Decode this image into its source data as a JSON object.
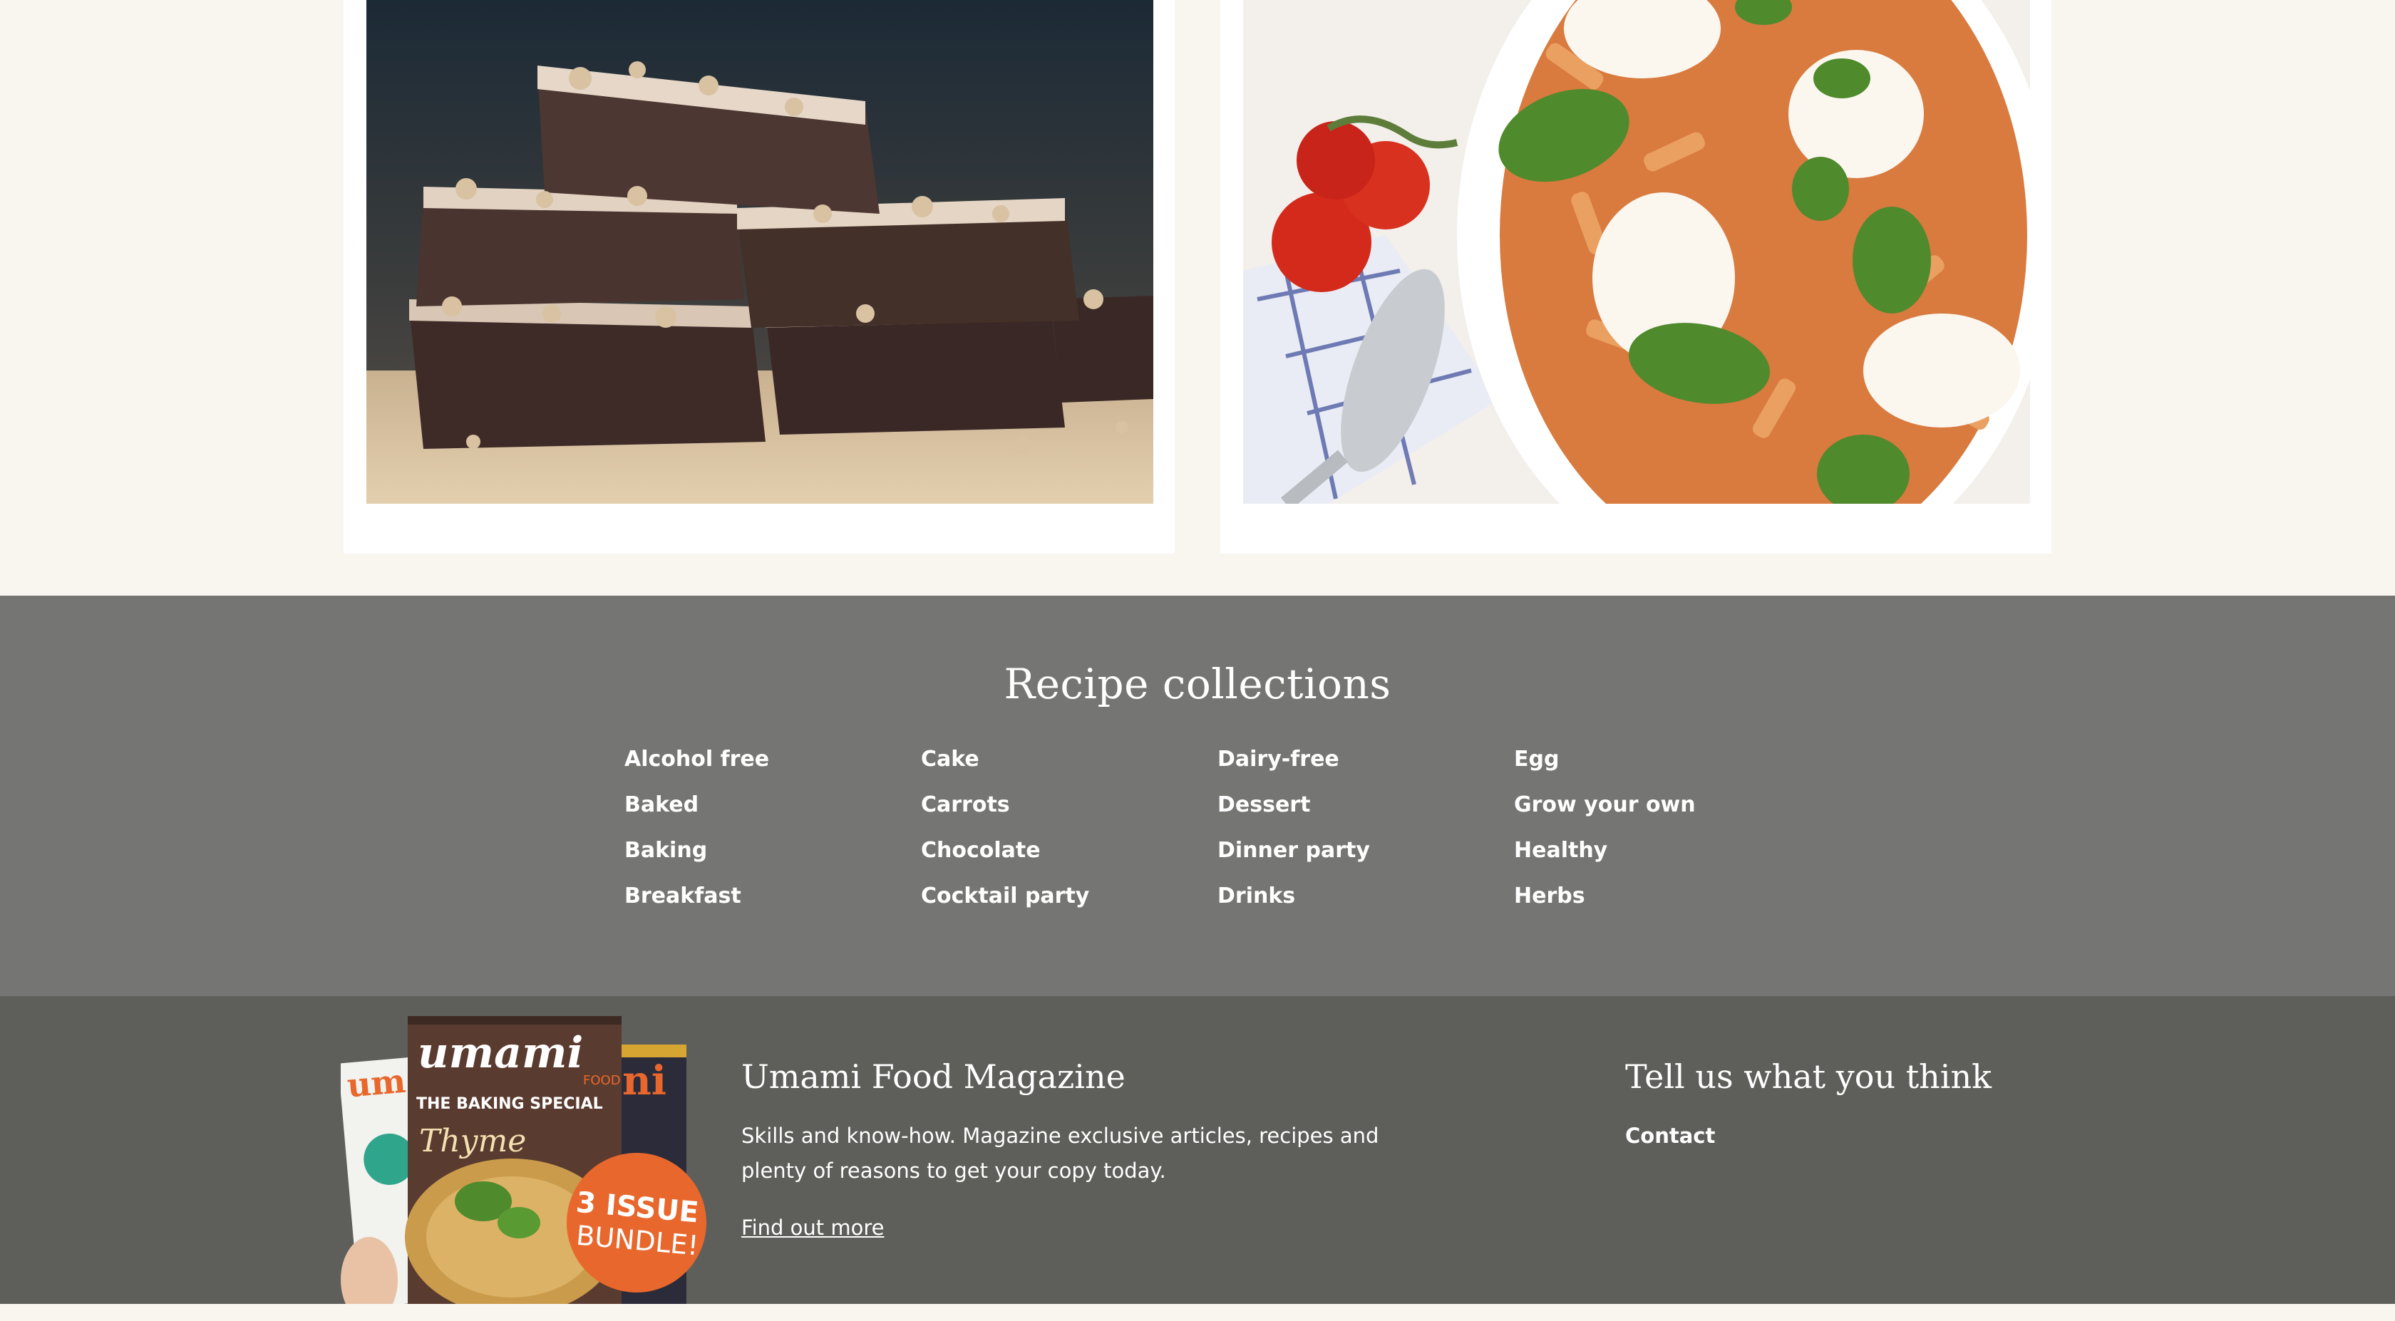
{
  "cards": [
    {
      "image": "chocolate-walnut-brownies-photo"
    },
    {
      "image": "baked-pasta-mozzarella-basil-photo"
    }
  ],
  "collections": {
    "title": "Recipe collections",
    "columns": [
      [
        "Alcohol free",
        "Baked",
        "Baking",
        "Breakfast"
      ],
      [
        "Cake",
        "Carrots",
        "Chocolate",
        "Cocktail party"
      ],
      [
        "Dairy-free",
        "Dessert",
        "Dinner party",
        "Drinks"
      ],
      [
        "Egg",
        "Grow your own",
        "Healthy",
        "Herbs"
      ]
    ]
  },
  "footer": {
    "magazine": {
      "title": "Umami Food Magazine",
      "description": "Skills and know-how. Magazine exclusive articles, recipes and plenty of reasons to get your copy today.",
      "link": "Find out more",
      "cover": {
        "brand": "umami",
        "brand_sub": "FOOD",
        "special": "THE BAKING SPECIAL",
        "feature": "Thyme",
        "badge_line1": "3 ISSUE",
        "badge_line2": "BUNDLE!"
      }
    },
    "feedback": {
      "title": "Tell us what you think",
      "contact": "Contact"
    }
  },
  "colors": {
    "page_bg": "#f9f5ef",
    "collections_bg": "#757573",
    "footer_bg": "#5e5f5b",
    "badge": "#e8672c"
  }
}
